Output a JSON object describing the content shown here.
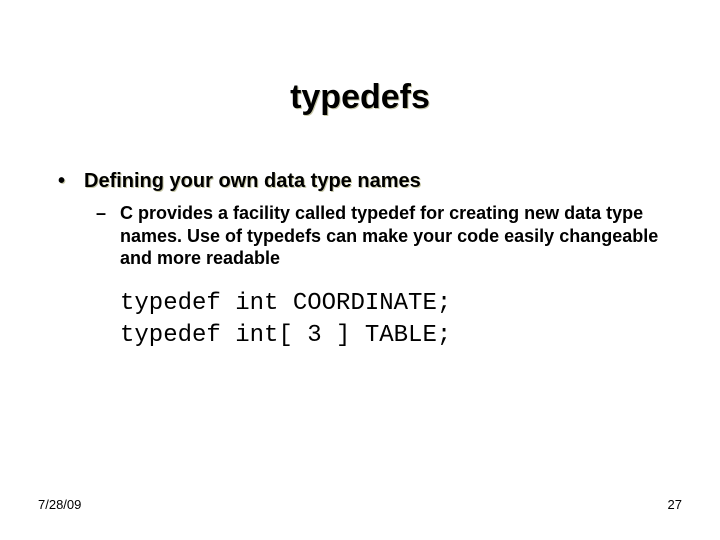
{
  "title": "typedefs",
  "bullet": {
    "symbol": "•",
    "text": "Defining your own data type names"
  },
  "subbullet": {
    "symbol": "–",
    "text": "C provides a facility called typedef for creating new data type names.  Use of typedefs can make your code easily changeable and  more readable"
  },
  "code": {
    "line1": "typedef int COORDINATE;",
    "line2": "typedef int[ 3 ] TABLE;"
  },
  "footer": {
    "date": "7/28/09",
    "page": "27"
  }
}
